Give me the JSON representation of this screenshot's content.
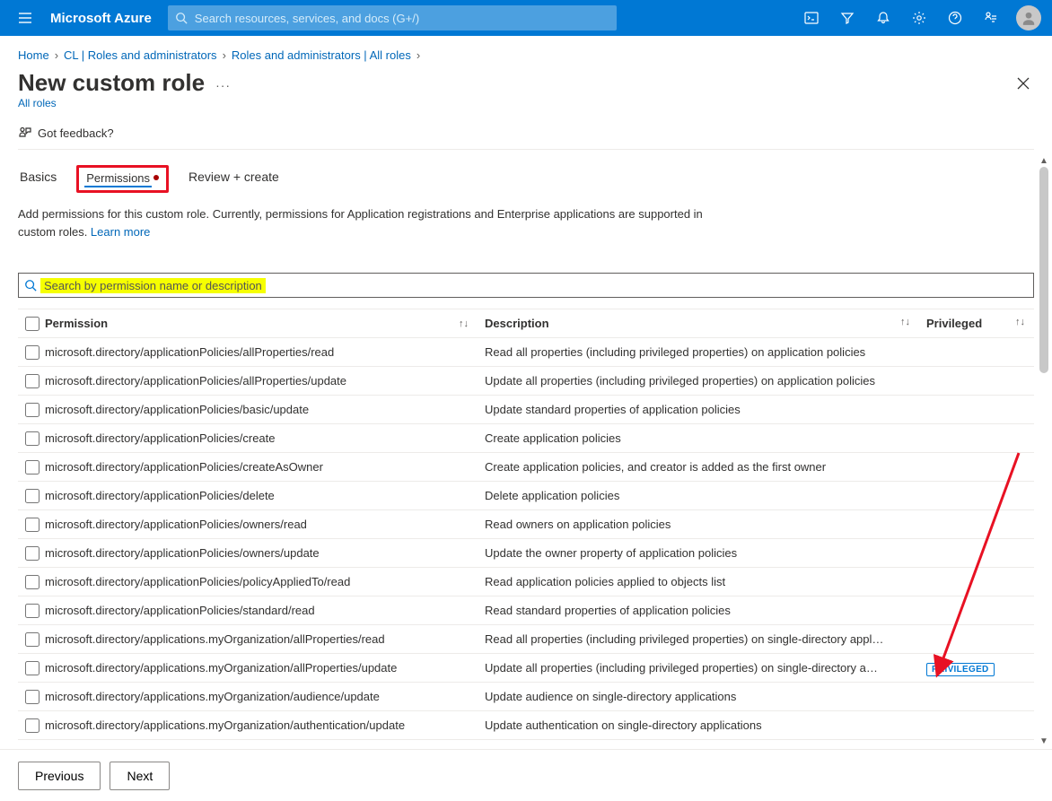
{
  "header": {
    "brand": "Microsoft Azure",
    "search_placeholder": "Search resources, services, and docs (G+/)"
  },
  "breadcrumb": {
    "items": [
      "Home",
      "CL | Roles and administrators",
      "Roles and administrators | All roles"
    ]
  },
  "page": {
    "title": "New custom role",
    "subtitle_link": "All roles",
    "feedback_label": "Got feedback?",
    "intro_text_1": "Add permissions for this custom role. Currently, permissions for Application registrations and Enterprise applications are supported in custom roles. ",
    "learn_more": "Learn more"
  },
  "tabs": {
    "basics": "Basics",
    "permissions": "Permissions",
    "review": "Review + create"
  },
  "perm_search": {
    "placeholder": "Search by permission name or description"
  },
  "table": {
    "head_permission": "Permission",
    "head_description": "Description",
    "head_privileged": "Privileged",
    "privileged_badge": "PRIVILEGED",
    "rows": [
      {
        "perm": "microsoft.directory/applicationPolicies/allProperties/read",
        "desc": "Read all properties (including privileged properties) on application policies",
        "priv": false
      },
      {
        "perm": "microsoft.directory/applicationPolicies/allProperties/update",
        "desc": "Update all properties (including privileged properties) on application policies",
        "priv": false
      },
      {
        "perm": "microsoft.directory/applicationPolicies/basic/update",
        "desc": "Update standard properties of application policies",
        "priv": false
      },
      {
        "perm": "microsoft.directory/applicationPolicies/create",
        "desc": "Create application policies",
        "priv": false
      },
      {
        "perm": "microsoft.directory/applicationPolicies/createAsOwner",
        "desc": "Create application policies, and creator is added as the first owner",
        "priv": false
      },
      {
        "perm": "microsoft.directory/applicationPolicies/delete",
        "desc": "Delete application policies",
        "priv": false
      },
      {
        "perm": "microsoft.directory/applicationPolicies/owners/read",
        "desc": "Read owners on application policies",
        "priv": false
      },
      {
        "perm": "microsoft.directory/applicationPolicies/owners/update",
        "desc": "Update the owner property of application policies",
        "priv": false
      },
      {
        "perm": "microsoft.directory/applicationPolicies/policyAppliedTo/read",
        "desc": "Read application policies applied to objects list",
        "priv": false
      },
      {
        "perm": "microsoft.directory/applicationPolicies/standard/read",
        "desc": "Read standard properties of application policies",
        "priv": false
      },
      {
        "perm": "microsoft.directory/applications.myOrganization/allProperties/read",
        "desc": "Read all properties (including privileged properties) on single-directory appl…",
        "priv": false
      },
      {
        "perm": "microsoft.directory/applications.myOrganization/allProperties/update",
        "desc": "Update all properties (including privileged properties) on single-directory a…",
        "priv": true
      },
      {
        "perm": "microsoft.directory/applications.myOrganization/audience/update",
        "desc": "Update audience on single-directory applications",
        "priv": false
      },
      {
        "perm": "microsoft.directory/applications.myOrganization/authentication/update",
        "desc": "Update authentication on single-directory applications",
        "priv": false
      }
    ]
  },
  "footer": {
    "prev": "Previous",
    "next": "Next"
  }
}
